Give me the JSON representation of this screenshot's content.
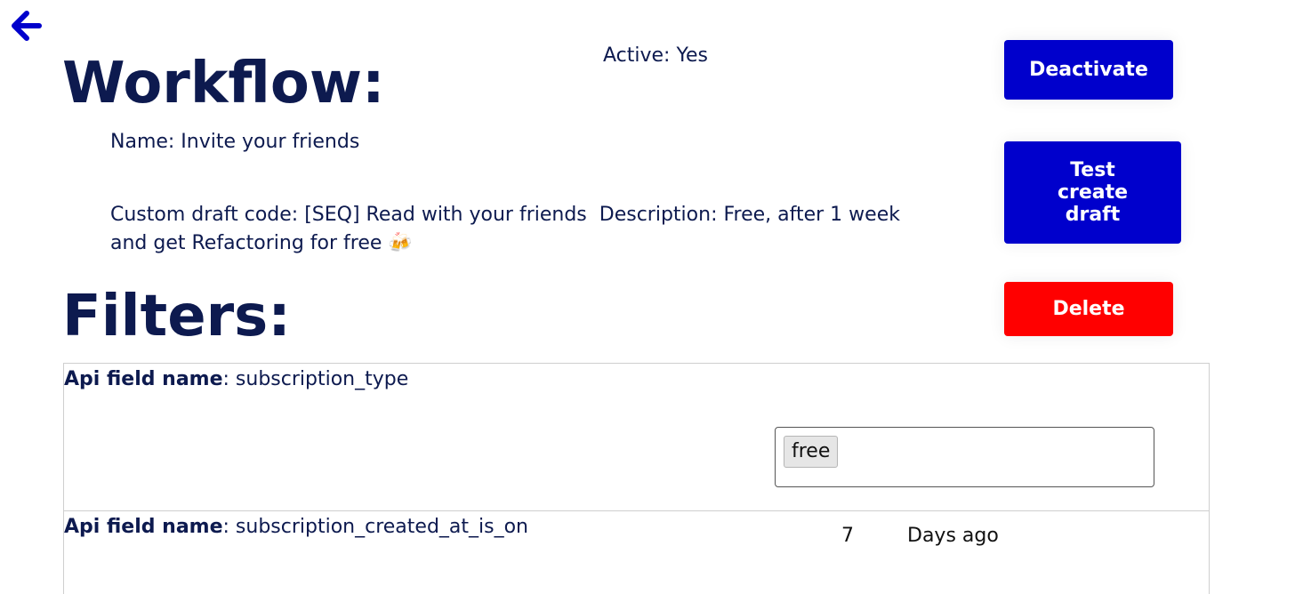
{
  "nav": {
    "back_icon": "arrow-left-icon",
    "back_color": "#0000cc"
  },
  "workflow": {
    "heading": "Workflow:",
    "active_text": "Active: Yes",
    "name_text": "Name: Invite your friends",
    "custom_draft_text": "Custom draft code: [SEQ] Read with your friends",
    "description_text": "Description: Free, after 1 week and get Refactoring for free 🍻"
  },
  "actions": {
    "deactivate_label": "Deactivate",
    "test_create_draft_label": "Test create draft",
    "delete_label": "Delete",
    "primary_color": "#0000cc",
    "danger_color": "#ff0000"
  },
  "filters": {
    "heading": "Filters:",
    "rows": [
      {
        "field_key_label": "Api field name",
        "field_value": ": subscription_type",
        "tags": [
          "free"
        ]
      },
      {
        "field_key_label": "Api field name",
        "field_value": ": subscription_created_at_is_on",
        "number_value": "7",
        "unit_label": "Days ago"
      }
    ]
  }
}
